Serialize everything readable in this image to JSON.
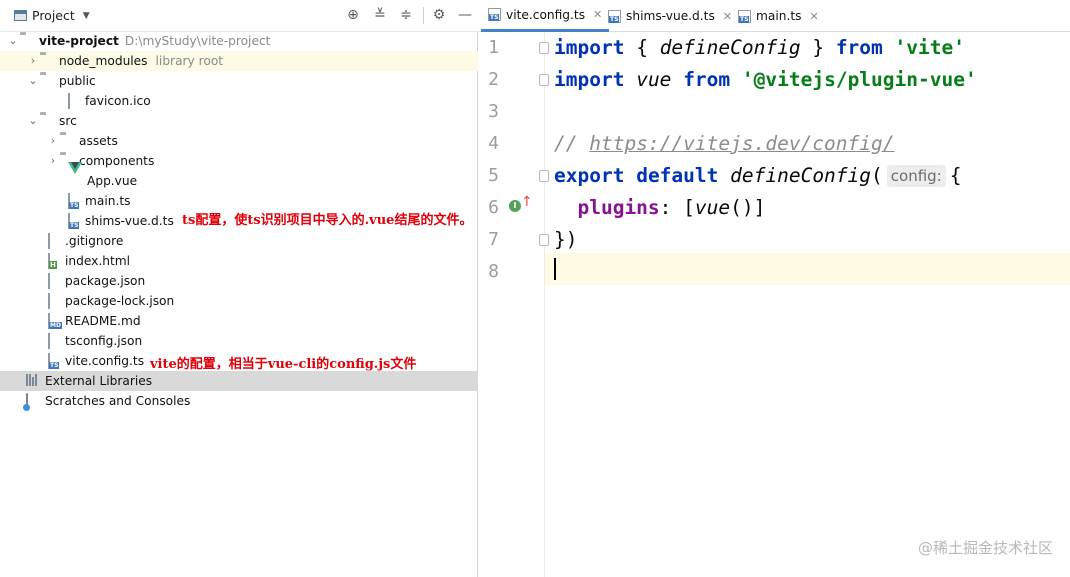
{
  "project_panel": {
    "title": "Project",
    "header_icons": [
      "locate-icon",
      "expand-all-icon",
      "collapse-all-icon",
      "gear-icon",
      "minimize-icon"
    ],
    "tree": [
      {
        "label": "vite-project",
        "hint": "D:\\myStudy\\vite-project",
        "type": "folder",
        "expanded": true,
        "bold": true
      },
      {
        "label": "node_modules",
        "hint": "library root",
        "type": "folder",
        "expanded": false
      },
      {
        "label": "public",
        "type": "folder",
        "expanded": true
      },
      {
        "label": "favicon.ico",
        "type": "file"
      },
      {
        "label": "src",
        "type": "folder",
        "expanded": true
      },
      {
        "label": "assets",
        "type": "folder",
        "expanded": false
      },
      {
        "label": "components",
        "type": "folder",
        "expanded": false
      },
      {
        "label": "App.vue",
        "type": "vue"
      },
      {
        "label": "main.ts",
        "type": "ts"
      },
      {
        "label": "shims-vue.d.ts",
        "type": "ts"
      },
      {
        "label": ".gitignore",
        "type": "file"
      },
      {
        "label": "index.html",
        "type": "html"
      },
      {
        "label": "package.json",
        "type": "file"
      },
      {
        "label": "package-lock.json",
        "type": "file"
      },
      {
        "label": "README.md",
        "type": "md"
      },
      {
        "label": "tsconfig.json",
        "type": "file"
      },
      {
        "label": "vite.config.ts",
        "type": "ts"
      },
      {
        "label": "External Libraries",
        "type": "library"
      },
      {
        "label": "Scratches and Consoles",
        "type": "scratch"
      }
    ],
    "annotations": {
      "shims": "ts配置，使ts识别项目中导入的.vue结尾的文件。",
      "vite_config": "vite的配置，相当于vue-cli的config.js文件"
    }
  },
  "editor": {
    "tabs": [
      {
        "label": "vite.config.ts",
        "active": true
      },
      {
        "label": "shims-vue.d.ts",
        "active": false
      },
      {
        "label": "main.ts",
        "active": false
      }
    ],
    "line_numbers": [
      "1",
      "2",
      "3",
      "4",
      "5",
      "6",
      "7",
      "8"
    ],
    "code": {
      "l1": {
        "kw1": "import",
        "p1": " { ",
        "name": "defineConfig",
        "p2": " } ",
        "kw2": "from",
        "sp": " ",
        "str": "'vite'"
      },
      "l2": {
        "kw1": "import",
        "sp1": " ",
        "name": "vue",
        "sp2": " ",
        "kw2": "from",
        "sp3": " ",
        "str": "'@vitejs/plugin-vue'"
      },
      "l4": {
        "prefix": "// ",
        "url": "https://vitejs.dev/config/"
      },
      "l5": {
        "kw1": "export",
        "sp1": " ",
        "kw2": "default",
        "sp2": " ",
        "fn": "defineConfig",
        "paren": "(",
        "hint": "config:",
        "brace": "{"
      },
      "l6": {
        "indent": "  ",
        "prop": "plugins",
        "colon": ": [",
        "fn": "vue",
        "rest": "()]"
      },
      "l7": {
        "text": "})"
      }
    }
  },
  "watermark": "@稀土掘金技术社区"
}
